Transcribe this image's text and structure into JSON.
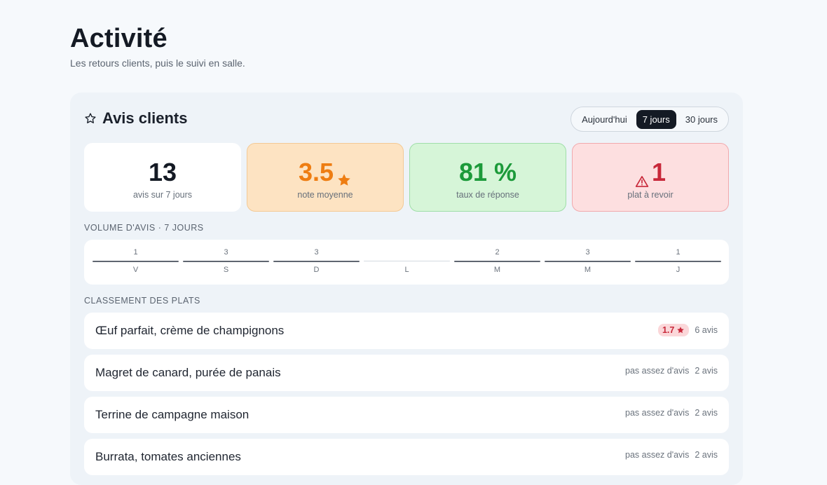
{
  "page": {
    "title": "Activité",
    "subtitle": "Les retours clients, puis le suivi en salle."
  },
  "reviews": {
    "title": "Avis clients",
    "title_icon": "star-outline-icon",
    "periods": [
      "Aujourd'hui",
      "7 jours",
      "30 jours"
    ],
    "active_period": "7 jours",
    "stats": [
      {
        "value": "13",
        "label": "avis sur 7 jours"
      },
      {
        "value": "3.5",
        "icon": "star-icon",
        "label": "note moyenne"
      },
      {
        "value": "81 %",
        "label": "taux de réponse"
      },
      {
        "value": "1",
        "icon": "warning-icon",
        "label": "plat à revoir"
      }
    ],
    "volume_label": "VOLUME D'AVIS · 7 JOURS",
    "volume": [
      {
        "day": "V",
        "count": "1"
      },
      {
        "day": "S",
        "count": "3"
      },
      {
        "day": "D",
        "count": "3"
      },
      {
        "day": "L",
        "count": ""
      },
      {
        "day": "M",
        "count": "2"
      },
      {
        "day": "M",
        "count": "3"
      },
      {
        "day": "J",
        "count": "1"
      }
    ],
    "ranking_label": "CLASSEMENT DES PLATS",
    "dishes": [
      {
        "name": "Œuf parfait, crème de champignons",
        "rating": "1.7",
        "note": "",
        "count": "6 avis"
      },
      {
        "name": "Magret de canard, purée de panais",
        "rating": "",
        "note": "pas assez d'avis",
        "count": "2 avis"
      },
      {
        "name": "Terrine de campagne maison",
        "rating": "",
        "note": "pas assez d'avis",
        "count": "2 avis"
      },
      {
        "name": "Burrata, tomates anciennes",
        "rating": "",
        "note": "pas assez d'avis",
        "count": "2 avis"
      }
    ]
  },
  "colors": {
    "accent_dark": "#141a24",
    "rating_orange": "#ee7d12",
    "success_green": "#1c9a3a",
    "danger_red": "#c8283a"
  }
}
